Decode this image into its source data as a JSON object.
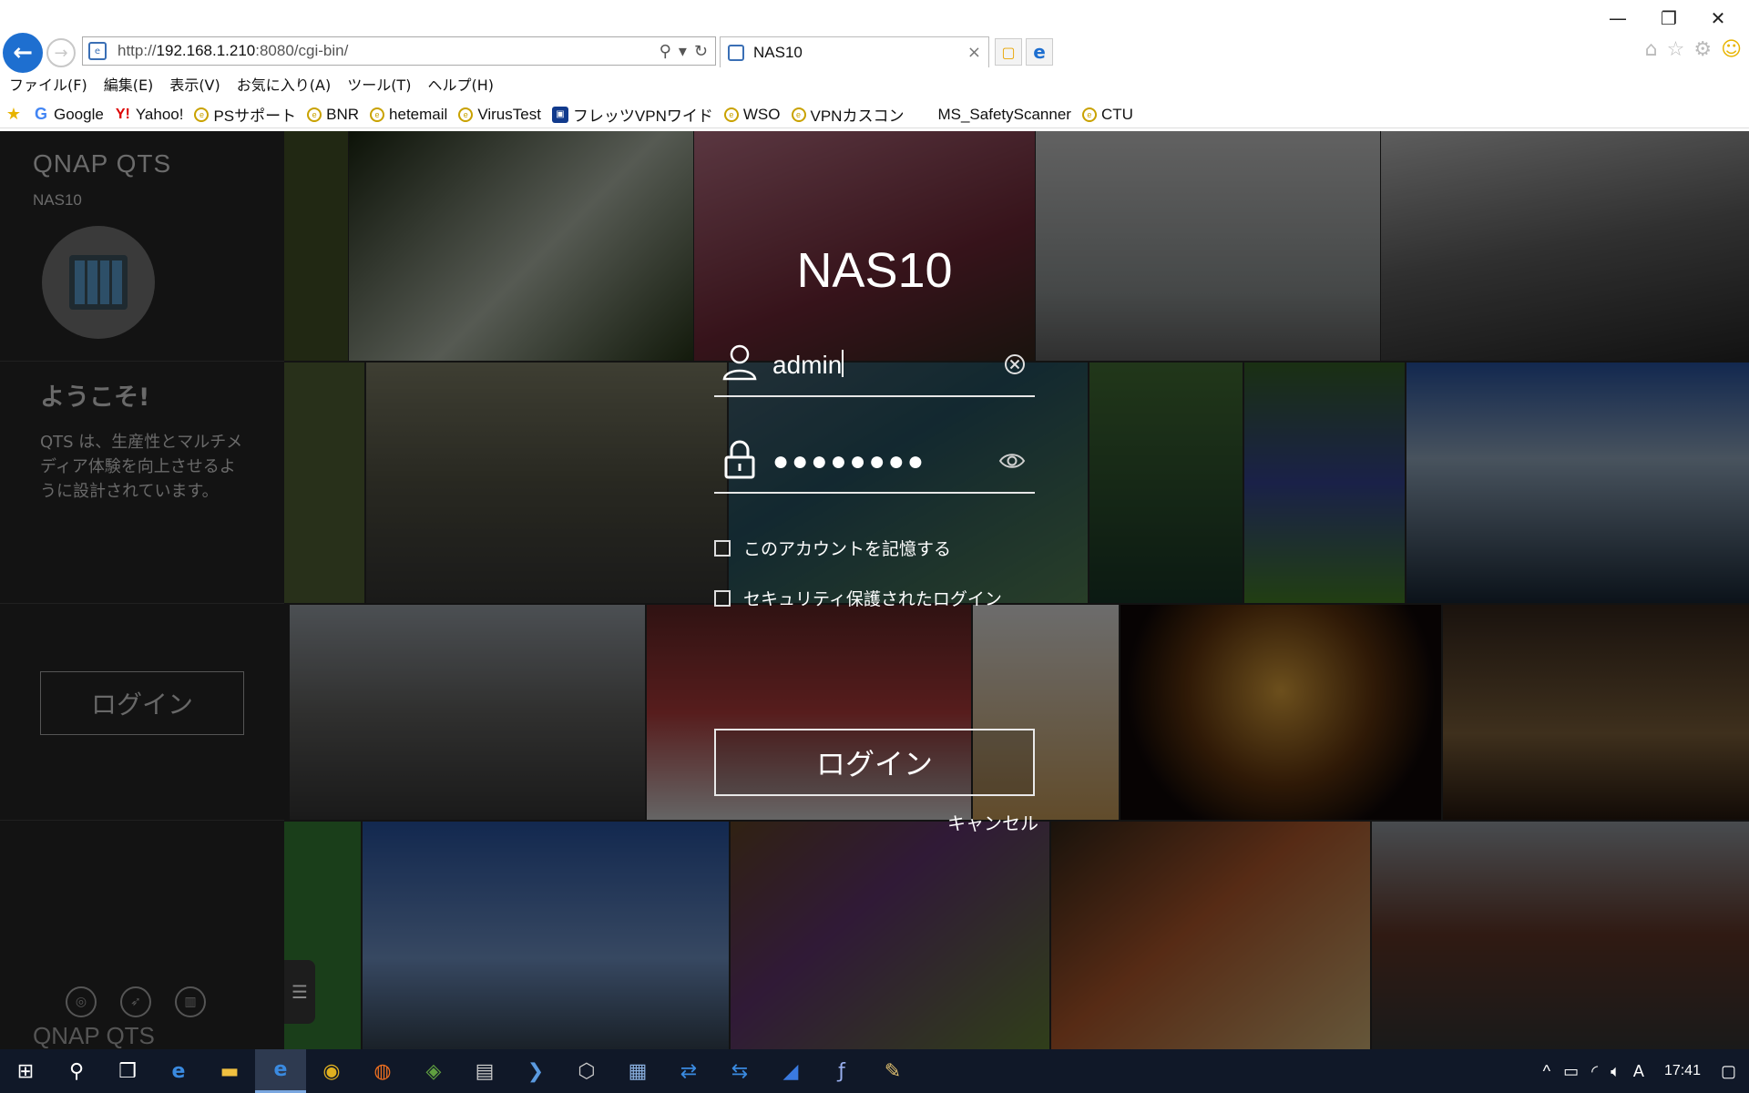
{
  "browser": {
    "address_prefix": "http://",
    "address_host": "192.168.1.210",
    "address_rest": ":8080/cgi-bin/",
    "tab_title": "NAS10",
    "tab_close": "×"
  },
  "menu": [
    "ファイル(F)",
    "編集(E)",
    "表示(V)",
    "お気に入り(A)",
    "ツール(T)",
    "ヘルプ(H)"
  ],
  "favorites": [
    {
      "label": "Google",
      "icon": "google-icon"
    },
    {
      "label": "Yahoo!",
      "icon": "yahoo-icon"
    },
    {
      "label": "PSサポート",
      "icon": "ie-page-icon"
    },
    {
      "label": "BNR",
      "icon": "ie-page-icon"
    },
    {
      "label": "hetemail",
      "icon": "ie-page-icon"
    },
    {
      "label": "VirusTest",
      "icon": "ie-page-icon"
    },
    {
      "label": "フレッツVPNワイド",
      "icon": "vpn-icon"
    },
    {
      "label": "WSO",
      "icon": "ie-page-icon"
    },
    {
      "label": "VPNカスコン",
      "icon": "ie-page-icon"
    },
    {
      "label": "MS_SafetyScanner",
      "icon": "microsoft-icon"
    },
    {
      "label": "CTU",
      "icon": "ie-page-icon"
    }
  ],
  "sidebar": {
    "app_title": "QNAP QTS",
    "host": "NAS10",
    "welcome": "ようこそ!",
    "description": "QTS は、生産性とマルチメディア体験を向上させるように設計されています。",
    "login_label": "ログイン",
    "footer": "QNAP QTS"
  },
  "login": {
    "title": "NAS10",
    "username": "admin",
    "password_mask": "●●●●●●●●",
    "remember_label": "このアカウントを記憶する",
    "secure_label": "セキュリティ保護されたログイン",
    "login_button": "ログイン",
    "cancel": "キャンセル"
  },
  "taskbar": {
    "clock": "17:41",
    "ime": "A"
  }
}
